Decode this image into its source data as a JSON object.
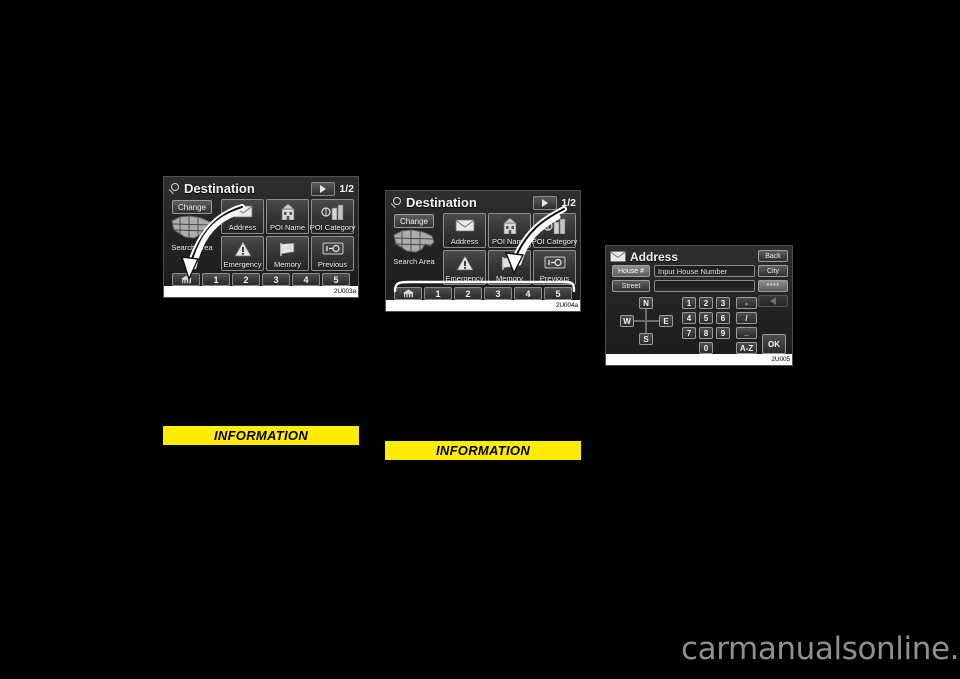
{
  "page": {
    "background_color": "#000000",
    "watermark": "carmanualsonline.info"
  },
  "screens": [
    {
      "id": "destination-1",
      "code_label": "2U003a",
      "title": "Destination",
      "title_icon": "magnifier-icon",
      "page_indicator": "1/2",
      "next_page_icon": "right-arrow-icon",
      "change_button": "Change",
      "search_area_label": "Search Area",
      "map_icon": "us-map-icon",
      "tiles": [
        {
          "label": "Address",
          "icon": "envelope-icon"
        },
        {
          "label": "POI Name",
          "icon": "building-icon"
        },
        {
          "label": "POI Category",
          "icon": "poi-category-icon"
        },
        {
          "label": "Emergency",
          "icon": "warning-triangle-icon"
        },
        {
          "label": "Memory",
          "icon": "flag-icon"
        },
        {
          "label": "Previous",
          "icon": "previous-screen-icon"
        }
      ],
      "bottom_keys": [
        "1",
        "2",
        "3",
        "4",
        "5"
      ],
      "home_key_icon": "home-icon",
      "annotation": "arrow-to-address"
    },
    {
      "id": "destination-2",
      "code_label": "2U004a",
      "title": "Destination",
      "title_icon": "magnifier-icon",
      "page_indicator": "1/2",
      "next_page_icon": "right-arrow-icon",
      "change_button": "Change",
      "search_area_label": "Search Area",
      "map_icon": "us-map-icon",
      "tiles": [
        {
          "label": "Address",
          "icon": "envelope-icon"
        },
        {
          "label": "POI Name",
          "icon": "building-icon"
        },
        {
          "label": "POI Category",
          "icon": "poi-category-icon"
        },
        {
          "label": "Emergency",
          "icon": "warning-triangle-icon"
        },
        {
          "label": "Memory",
          "icon": "flag-icon"
        },
        {
          "label": "Previous",
          "icon": "previous-screen-icon"
        }
      ],
      "bottom_keys": [
        "1",
        "2",
        "3",
        "4",
        "5"
      ],
      "home_key_icon": "home-icon",
      "annotation": "arrow-to-memory-and-bracket"
    }
  ],
  "address_screen": {
    "id": "address",
    "code_label": "2U005",
    "title": "Address",
    "title_icon": "envelope-icon",
    "back_button": "Back",
    "city_button": "City",
    "stars_button": "****",
    "house_number_button": "House #",
    "street_button": "Street",
    "house_number_value": "Input House Number",
    "street_value": "",
    "back_arrow_icon": "left-arrow-icon",
    "compass": {
      "north": "N",
      "south": "S",
      "east": "E",
      "west": "W"
    },
    "keypad": [
      [
        "1",
        "2",
        "3",
        "-"
      ],
      [
        "4",
        "5",
        "6",
        "/"
      ],
      [
        "7",
        "8",
        "9",
        "_"
      ],
      [
        "0",
        "A-Z"
      ]
    ],
    "ok_button": "OK"
  },
  "banners": [
    {
      "id": "information-1",
      "text": "INFORMATION",
      "color": "#ffec00"
    },
    {
      "id": "information-2",
      "text": "INFORMATION",
      "color": "#ffec00"
    }
  ]
}
